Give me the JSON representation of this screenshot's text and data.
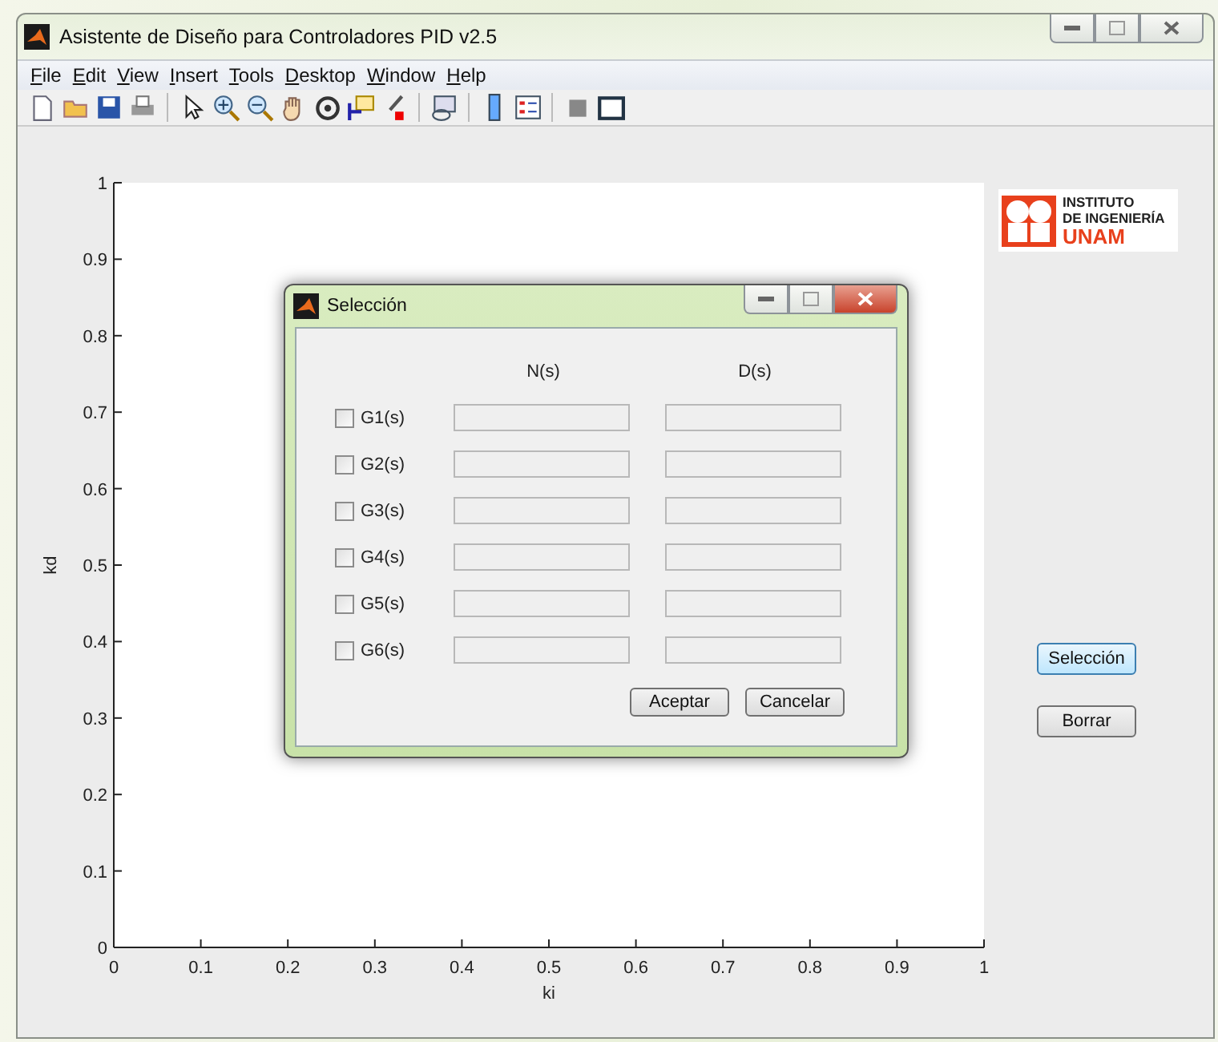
{
  "window": {
    "title": "Asistente de Diseño para Controladores PID v2.5"
  },
  "menu": [
    "File",
    "Edit",
    "View",
    "Insert",
    "Tools",
    "Desktop",
    "Window",
    "Help"
  ],
  "axes": {
    "chart_data": {
      "type": "line",
      "xlabel": "ki",
      "ylabel": "kd",
      "xlim": [
        0,
        1
      ],
      "ylim": [
        0,
        1
      ],
      "xticks": [
        0,
        {
          "value": 0.1,
          "label": "0.1"
        },
        {
          "value": 0.2,
          "label": "0.2"
        },
        {
          "value": 0.3,
          "label": "0.3"
        },
        {
          "value": 0.4,
          "label": "0.4"
        },
        {
          "value": 0.5,
          "label": "0.5"
        },
        {
          "value": 0.6,
          "label": "0.6"
        },
        {
          "value": 0.7,
          "label": "0.7"
        },
        {
          "value": 0.8,
          "label": "0.8"
        },
        {
          "value": 0.9,
          "label": "0.9"
        },
        1
      ],
      "yticks": [
        0,
        {
          "value": 0.1,
          "label": "0.1"
        },
        {
          "value": 0.2,
          "label": "0.2"
        },
        {
          "value": 0.3,
          "label": "0.3"
        },
        {
          "value": 0.4,
          "label": "0.4"
        },
        {
          "value": 0.5,
          "label": "0.5"
        },
        {
          "value": 0.6,
          "label": "0.6"
        },
        {
          "value": 0.7,
          "label": "0.7"
        },
        {
          "value": 0.8,
          "label": "0.8"
        },
        {
          "value": 0.9,
          "label": "0.9"
        },
        1
      ]
    }
  },
  "logo": {
    "lines": [
      "INSTITUTO",
      "DE INGENIERÍA",
      "UNAM"
    ]
  },
  "buttons": [
    {
      "label": "Selección",
      "focused": true
    },
    {
      "label": "Borrar",
      "focused": false
    }
  ],
  "dialog": {
    "title": "Selección",
    "columns": [
      "N(s)",
      "D(s)"
    ],
    "rows": [
      {
        "label": "G1(s)",
        "checked": false
      },
      {
        "label": "G2(s)",
        "checked": false
      },
      {
        "label": "G3(s)",
        "checked": false
      },
      {
        "label": "G4(s)",
        "checked": false
      },
      {
        "label": "G5(s)",
        "checked": false
      },
      {
        "label": "G6(s)",
        "checked": false
      }
    ],
    "buttons": [
      "Aceptar",
      "Cancelar"
    ]
  }
}
